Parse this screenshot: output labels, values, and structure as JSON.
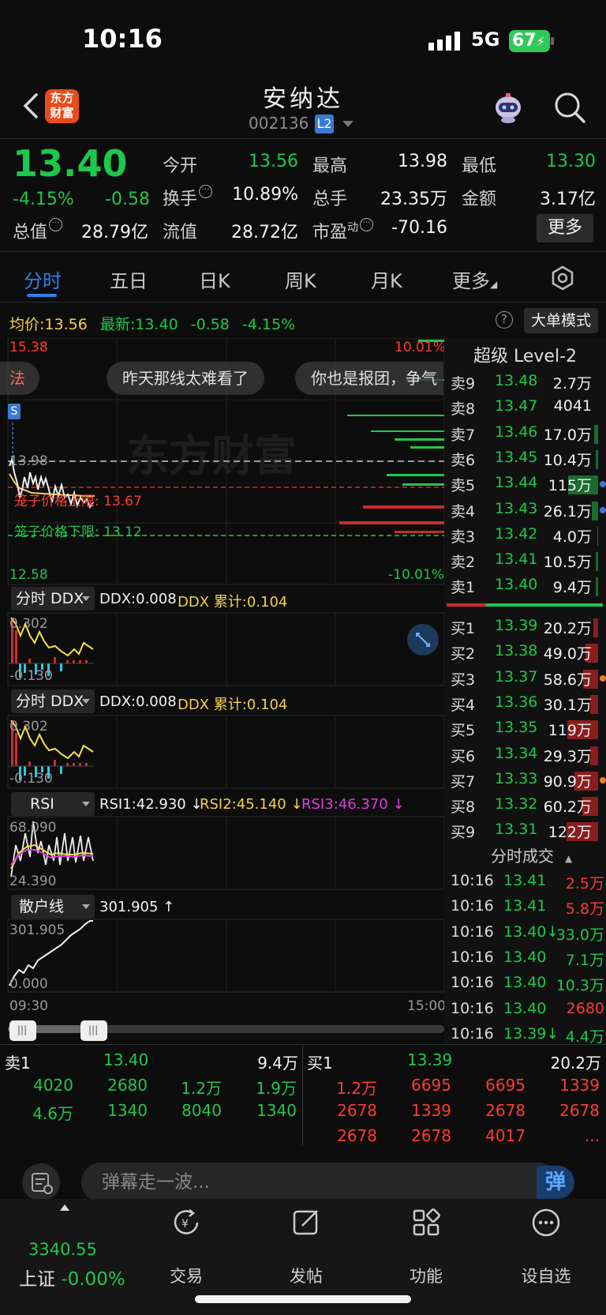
{
  "status": {
    "time": "10:16",
    "network": "5G",
    "battery": "67"
  },
  "header": {
    "logo_line1": "东方",
    "logo_line2": "财富",
    "name": "安纳达",
    "code": "002136",
    "level_badge": "L2"
  },
  "quote": {
    "price": "13.40",
    "pct": "-4.15%",
    "chg": "-0.58",
    "rows": [
      [
        {
          "label": "今开",
          "value": "13.56",
          "color": "green"
        },
        {
          "label": "最高",
          "value": "13.98",
          "color": "white"
        },
        {
          "label": "最低",
          "value": "13.30",
          "color": "green"
        }
      ],
      [
        {
          "label": "换手",
          "value": "10.89%",
          "color": "white"
        },
        {
          "label": "总手",
          "value": "23.35万",
          "color": "white"
        },
        {
          "label": "金额",
          "value": "3.17亿",
          "color": "white"
        }
      ],
      [
        {
          "label": "总值",
          "value": "28.79亿",
          "color": "white"
        },
        {
          "label": "流值",
          "value": "28.72亿",
          "color": "white"
        },
        {
          "label": "市盈",
          "value": "-70.16",
          "color": "white"
        }
      ]
    ],
    "pe_sup": "动",
    "more_label": "更多"
  },
  "tabs": [
    "分时",
    "五日",
    "日K",
    "周K",
    "月K",
    "更多"
  ],
  "chart_info": {
    "avg_label": "均价:",
    "avg_value": "13.56",
    "latest_label": "最新:",
    "latest_value": "13.40",
    "latest_chg": "-0.58",
    "latest_pct": "-4.15%",
    "bigorder_label": "大单模式"
  },
  "main_chart": {
    "y_top": "15.38",
    "y_bottom": "12.58",
    "pct_top": "10.01%",
    "pct_bottom": "-10.01%",
    "ref_line": "13.98",
    "cage_upper": "笼子价格上限: 13.67",
    "cage_lower": "笼子价格下限: 13.12",
    "watermark": "东方财富",
    "s_marker": "S",
    "danmu": [
      "法",
      "昨天那线太难看了",
      "你也是报团，争气"
    ]
  },
  "indicators": [
    {
      "name": "分时 DDX",
      "text1": "DDX:0.008",
      "text2": "DDX 累计:0.104",
      "top": "0.302",
      "bottom": "-0.130"
    },
    {
      "name": "分时 DDX",
      "text1": "DDX:0.008",
      "text2": "DDX 累计:0.104",
      "top": "0.302",
      "bottom": "-0.130"
    },
    {
      "name": "RSI",
      "rsi1": "RSI1:42.930 ↓",
      "rsi2": "RSI2:45.140 ↓",
      "rsi3": "RSI3:46.370 ↓",
      "top": "68.090",
      "bottom": "24.390"
    },
    {
      "name": "散户线",
      "text1": "301.905 ↑",
      "top": "301.905",
      "bottom": "0.000"
    }
  ],
  "time_axis": {
    "start": "09:30",
    "end": "15:00"
  },
  "orderbook": {
    "title": "超级 Level-2",
    "asks": [
      {
        "label": "卖9",
        "price": "13.48",
        "vol": "2.7万",
        "bar": 0.0,
        "dot": ""
      },
      {
        "label": "卖8",
        "price": "13.47",
        "vol": "4041",
        "bar": 0.0,
        "dot": ""
      },
      {
        "label": "卖7",
        "price": "13.46",
        "vol": "17.0万",
        "bar": 0.12,
        "dot": ""
      },
      {
        "label": "卖6",
        "price": "13.45",
        "vol": "10.4万",
        "bar": 0.08,
        "dot": ""
      },
      {
        "label": "卖5",
        "price": "13.44",
        "vol": "115万",
        "bar": 0.95,
        "dot": "#3a7bd5"
      },
      {
        "label": "卖4",
        "price": "13.43",
        "vol": "26.1万",
        "bar": 0.2,
        "dot": "#3a7bd5"
      },
      {
        "label": "卖3",
        "price": "13.42",
        "vol": "4.0万",
        "bar": 0.03,
        "dot": ""
      },
      {
        "label": "卖2",
        "price": "13.41",
        "vol": "10.5万",
        "bar": 0.08,
        "dot": ""
      },
      {
        "label": "卖1",
        "price": "13.40",
        "vol": "9.4万",
        "bar": 0.07,
        "dot": ""
      }
    ],
    "bids": [
      {
        "label": "买1",
        "price": "13.39",
        "vol": "20.2万",
        "bar": 0.16,
        "dot": ""
      },
      {
        "label": "买2",
        "price": "13.38",
        "vol": "49.0万",
        "bar": 0.4,
        "dot": ""
      },
      {
        "label": "买3",
        "price": "13.37",
        "vol": "58.6万",
        "bar": 0.48,
        "dot": "#f07a2a"
      },
      {
        "label": "买4",
        "price": "13.36",
        "vol": "30.1万",
        "bar": 0.25,
        "dot": ""
      },
      {
        "label": "买5",
        "price": "13.35",
        "vol": "119万",
        "bar": 0.98,
        "dot": ""
      },
      {
        "label": "买6",
        "price": "13.34",
        "vol": "29.3万",
        "bar": 0.24,
        "dot": ""
      },
      {
        "label": "买7",
        "price": "13.33",
        "vol": "90.9万",
        "bar": 0.75,
        "dot": "#f07a2a"
      },
      {
        "label": "买8",
        "price": "13.32",
        "vol": "60.2万",
        "bar": 0.5,
        "dot": ""
      },
      {
        "label": "买9",
        "price": "13.31",
        "vol": "122万",
        "bar": 1.0,
        "dot": ""
      }
    ]
  },
  "ticks": {
    "title": "分时成交",
    "rows": [
      {
        "time": "10:16",
        "price": "13.41",
        "vol": "2.5万",
        "vcolor": "red"
      },
      {
        "time": "10:16",
        "price": "13.41",
        "vol": "5.8万",
        "vcolor": "red"
      },
      {
        "time": "10:16",
        "price": "13.40↓",
        "vol": "33.0万",
        "vcolor": "green"
      },
      {
        "time": "10:16",
        "price": "13.40",
        "vol": "7.1万",
        "vcolor": "green"
      },
      {
        "time": "10:16",
        "price": "13.40",
        "vol": "10.3万",
        "vcolor": "green"
      },
      {
        "time": "10:16",
        "price": "13.40",
        "vol": "2680",
        "vcolor": "red"
      },
      {
        "time": "10:16",
        "price": "13.39↓",
        "vol": "4.4万",
        "vcolor": "green"
      }
    ]
  },
  "queue": {
    "sell": {
      "label": "卖1",
      "price": "13.40",
      "vol": "9.4万",
      "rows": [
        [
          "4020",
          "2680",
          "1.2万",
          "1.9万"
        ],
        [
          "4.6万",
          "1340",
          "8040",
          "1340"
        ]
      ]
    },
    "buy": {
      "label": "买1",
      "price": "13.39",
      "vol": "20.2万",
      "rows": [
        [
          "1.2万",
          "6695",
          "6695",
          "1339"
        ],
        [
          "2678",
          "1339",
          "2678",
          "2678"
        ],
        [
          "2678",
          "2678",
          "4017",
          "..."
        ]
      ]
    }
  },
  "barrage": {
    "placeholder": "弹幕走一波...",
    "button": "弹"
  },
  "nav": {
    "index_value": "3340.55",
    "index_name": "上证",
    "index_pct": "-0.00%",
    "items": [
      "交易",
      "发帖",
      "功能",
      "设自选"
    ]
  }
}
